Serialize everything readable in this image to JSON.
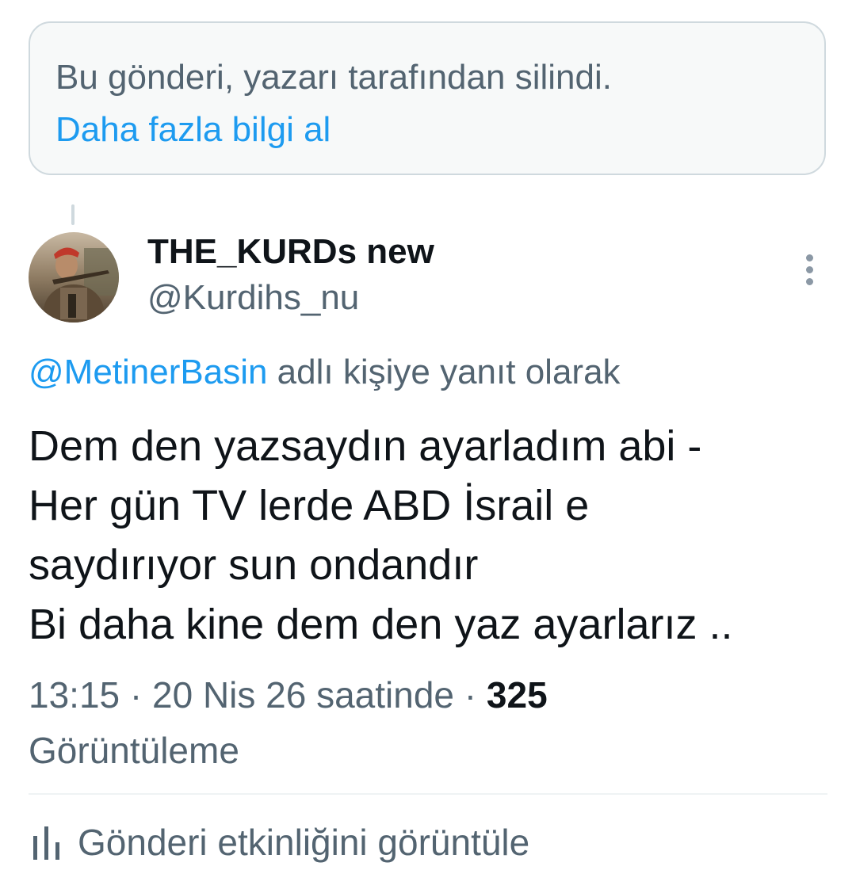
{
  "deleted_notice": {
    "text": "Bu gönderi, yazarı tarafından silindi.",
    "link": "Daha fazla bilgi al"
  },
  "tweet": {
    "author": {
      "display_name": "THE_KURDs new",
      "handle": "@Kurdihs_nu",
      "avatar_icon": "user-avatar"
    },
    "more_icon": "more-options-icon",
    "reply_to": {
      "mention": "@MetinerBasin",
      "suffix": " adlı kişiye yanıt olarak"
    },
    "body_lines": [
      "Dem den yazsaydın ayarladım abi -",
      "Her gün TV lerde ABD İsrail e",
      "saydırıyor sun ondandır",
      "Bi daha kine dem den yaz ayarlarız .."
    ],
    "meta": {
      "timestamp": "13:15 · 20 Nis 26 saatinde",
      "separator": " · ",
      "view_count": "325",
      "view_label": "Görüntüleme"
    }
  },
  "activity": {
    "label": "Gönderi etkinliğini görüntüle",
    "icon": "bar-chart-icon"
  },
  "colors": {
    "accent": "#1d9bf0",
    "secondary_text": "#536471",
    "primary_text": "#0f1419",
    "notice_bg": "#f7f9f9",
    "border": "#cfd9de"
  }
}
